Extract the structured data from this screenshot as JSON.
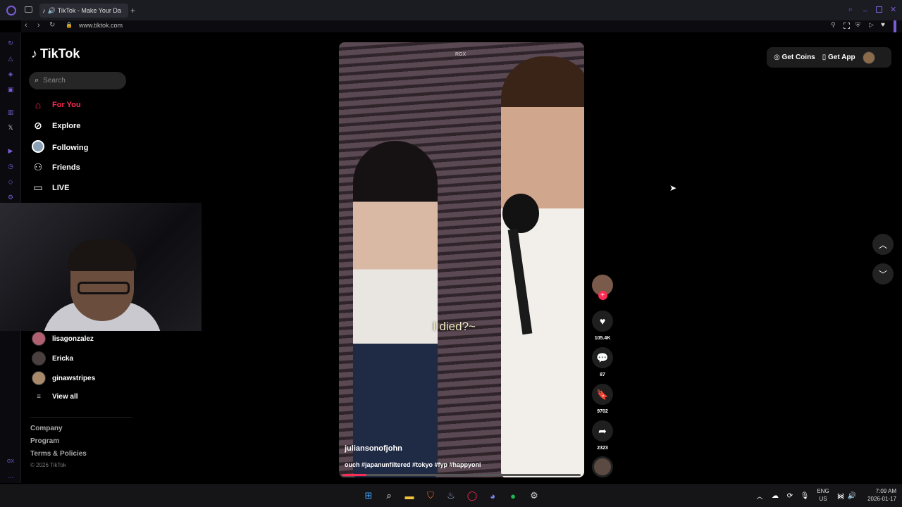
{
  "browser": {
    "tab_title": "TikTok - Make Your Da",
    "url": "www.tiktok.com"
  },
  "tiktok": {
    "logo": "TikTok",
    "search_placeholder": "Search",
    "nav": [
      {
        "label": "For You",
        "icon": "home-icon",
        "active": true
      },
      {
        "label": "Explore",
        "icon": "compass-icon",
        "active": false
      },
      {
        "label": "Following",
        "icon": "following-avatar-icon",
        "active": false
      },
      {
        "label": "Friends",
        "icon": "friends-icon",
        "active": false
      },
      {
        "label": "LIVE",
        "icon": "live-icon",
        "active": false
      }
    ],
    "following_accounts": [
      "lisagonzalez",
      "Ericka",
      "ginawstripes"
    ],
    "view_all": "View all",
    "footer_links": [
      "Company",
      "Program",
      "Terms & Policies"
    ],
    "copyright": "© 2026 TikTok",
    "header": {
      "get_coins": "Get Coins",
      "get_app": "Get App"
    }
  },
  "video": {
    "watermark": "RGX",
    "subtitle": "I died?~",
    "author": "juliansonofjohn",
    "caption": "ouch #japanunfiltered #tokyo #fyp #happyoni",
    "progress_fraction": 0.1,
    "likes": "105.4K",
    "comments": "87",
    "saves": "9702",
    "shares": "2323"
  },
  "taskbar": {
    "lang_line1": "ENG",
    "lang_line2": "US",
    "time": "7:09 AM",
    "date": "2026-01-17"
  },
  "colors": {
    "accent": "#fe2c55",
    "opera_purple": "#7a5cd4"
  }
}
